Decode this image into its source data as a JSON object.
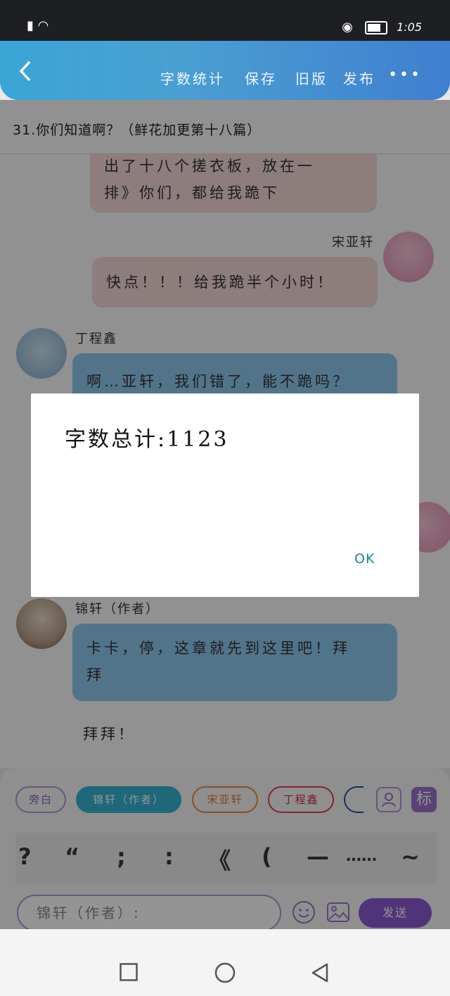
{
  "status_bar": {
    "time": "1:05"
  },
  "header": {
    "back_icon": "chevron-left-icon",
    "menu": [
      "字数统计",
      "保存",
      "旧版",
      "发布"
    ],
    "more_label": "•••"
  },
  "chapter_title": "31.你们知道啊？（鲜花加更第十八篇）",
  "chat": {
    "partial_top_line1": "出了十八个搓衣板，放在一",
    "partial_top_line2": "排》你们，都给我跪下",
    "speaker1_name": "宋亚轩",
    "speaker1_text": "快点！！！给我跪半个小时！",
    "speaker2_name": "丁程鑫",
    "speaker2_text": "啊…亚轩，我们错了，能不跪吗？",
    "speaker3_name": "锦轩（作者）",
    "speaker3_text_line1": "卡卡，停，这章就先到这里吧！拜",
    "speaker3_text_line2": "拜",
    "narration": "拜拜！"
  },
  "role_chips": [
    "旁白",
    "锦轩（作者）",
    "宋亚轩",
    "丁程鑫"
  ],
  "mark_button_label": "标",
  "punctuation": [
    "?",
    "“",
    ";",
    ":",
    "《",
    "(",
    "—",
    "……",
    "~"
  ],
  "input": {
    "value": "锦轩（作者）:"
  },
  "send_label": "发送",
  "dialog": {
    "message": "字数总计:1123",
    "ok_label": "OK"
  },
  "colors": {
    "header_start": "#3aa6d6",
    "header_end": "#3f7fd0",
    "pink_bubble": "#f3d7d8",
    "blue_bubble": "#8dc9ef",
    "send_button": "#8a5bd0",
    "ok_text": "#178a8f"
  }
}
